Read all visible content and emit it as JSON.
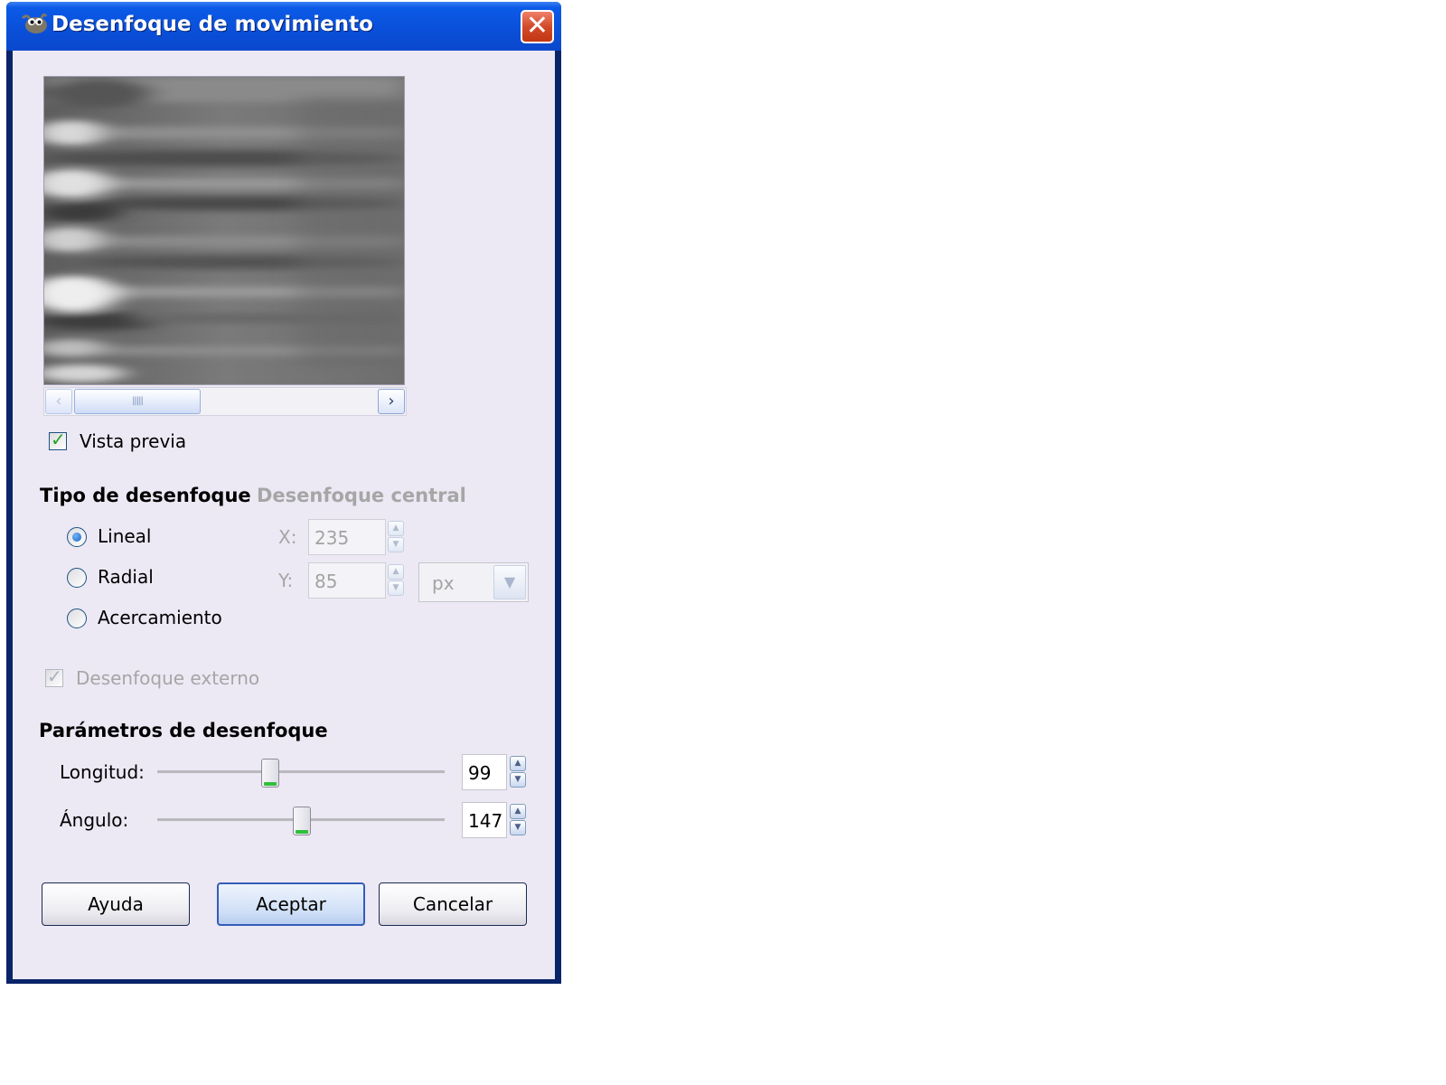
{
  "window": {
    "title": "Desenfoque de movimiento",
    "close_glyph": "✕",
    "app_icon": "gimp-icon"
  },
  "preview": {
    "checkbox_label": "Vista previa",
    "checked": true
  },
  "blur_type": {
    "heading": "Tipo de desenfoque",
    "options": [
      {
        "label": "Lineal",
        "selected": true
      },
      {
        "label": "Radial",
        "selected": false
      },
      {
        "label": "Acercamiento",
        "selected": false
      }
    ]
  },
  "center": {
    "heading": "Desenfoque central",
    "x_label": "X:",
    "x_value": "235",
    "y_label": "Y:",
    "y_value": "85",
    "unit": "px"
  },
  "outward": {
    "label": "Desenfoque externo",
    "checked": true
  },
  "params": {
    "heading": "Parámetros de desenfoque",
    "length_label": "Longitud:",
    "length_value": "99",
    "angle_label": "Ángulo:",
    "angle_value": "147"
  },
  "buttons": {
    "help": "Ayuda",
    "ok": "Aceptar",
    "cancel": "Cancelar"
  },
  "colors": {
    "title_bar": "#0a4fd8",
    "dialog_bg": "#ece9f4",
    "check_green": "#21a121",
    "default_button_border": "#335db7"
  }
}
